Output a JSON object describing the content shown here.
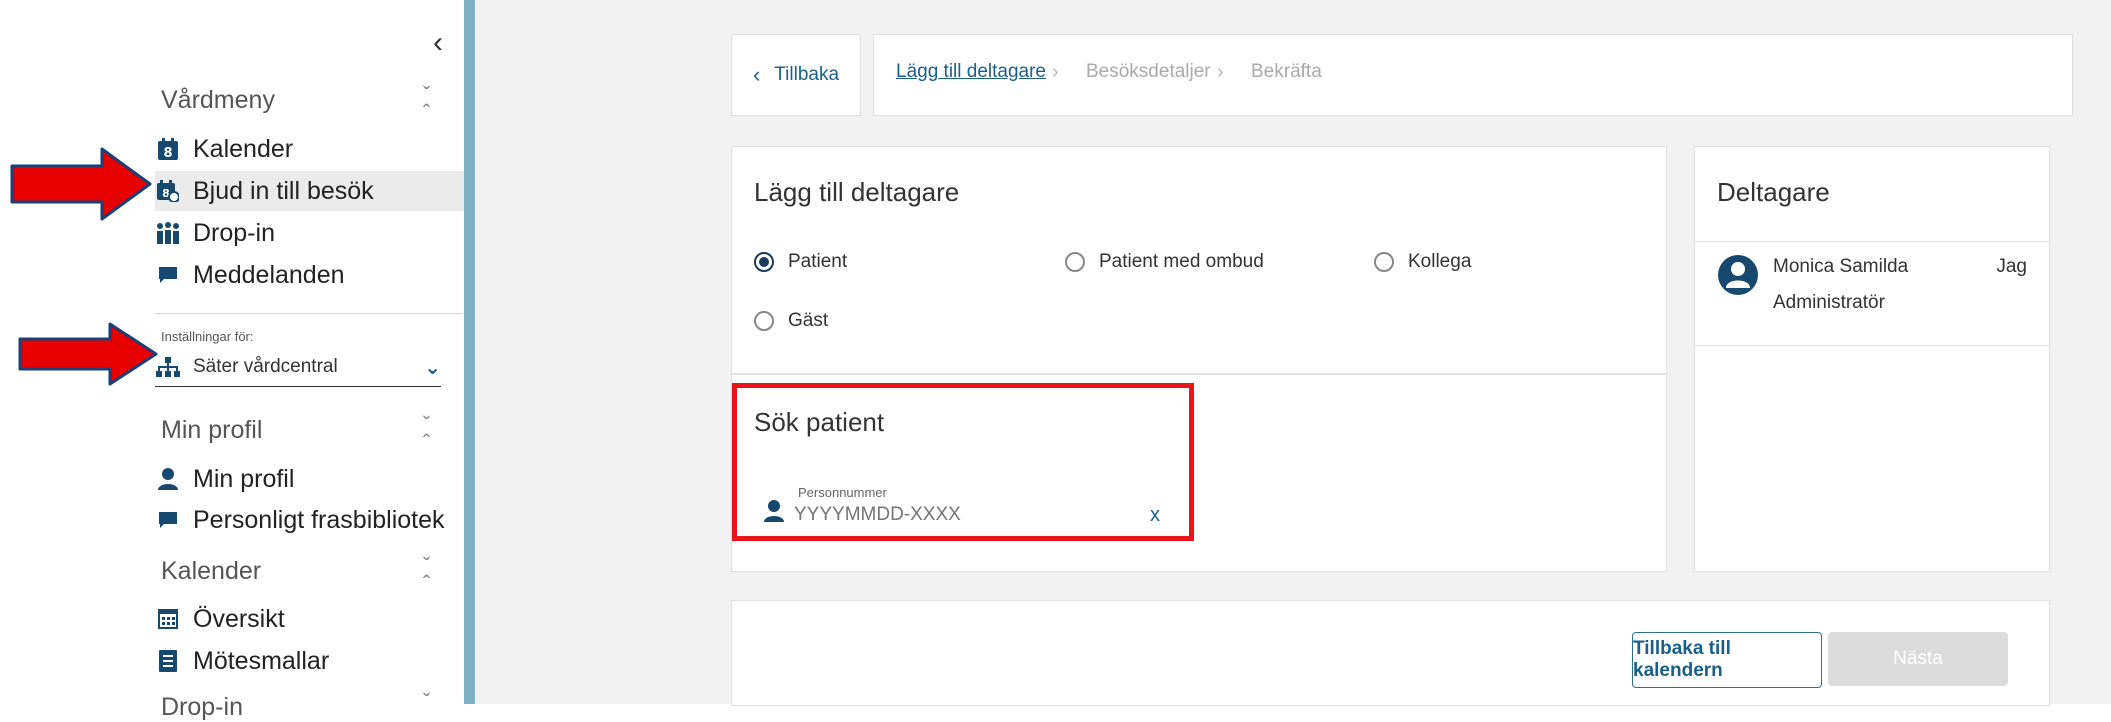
{
  "sidebar": {
    "collapse_icon": "chevron-left-icon",
    "vardmeny": {
      "title": "Vårdmeny",
      "items": [
        {
          "label": "Kalender",
          "icon": "calendar-8-icon"
        },
        {
          "label": "Bjud in till besök",
          "icon": "calendar-invite-icon"
        },
        {
          "label": "Drop-in",
          "icon": "people-icon"
        },
        {
          "label": "Meddelanden",
          "icon": "chat-icon"
        }
      ]
    },
    "settings": {
      "label": "Inställningar för:",
      "value": "Säter vårdcentral",
      "icon": "org-chart-icon"
    },
    "min_profil": {
      "title": "Min profil",
      "items": [
        {
          "label": "Min profil",
          "icon": "user-icon"
        },
        {
          "label": "Personligt frasbibliotek",
          "icon": "chat-icon"
        }
      ]
    },
    "kalender": {
      "title": "Kalender",
      "items": [
        {
          "label": "Översikt",
          "icon": "calendar-grid-icon"
        },
        {
          "label": "Mötesmallar",
          "icon": "document-list-icon"
        }
      ]
    },
    "cut_off": {
      "title": "Drop-in"
    }
  },
  "topbar": {
    "back_label": "Tillbaka",
    "breadcrumbs": [
      "Lägg till deltagare",
      "Besöksdetaljer",
      "Bekräfta"
    ]
  },
  "add_participant": {
    "title": "Lägg till deltagare",
    "options": [
      "Patient",
      "Patient med ombud",
      "Kollega",
      "Gäst"
    ],
    "selected": "Patient"
  },
  "search": {
    "title": "Sök patient",
    "field_label": "Personnummer",
    "placeholder": "YYYYMMDD-XXXX",
    "clear_label": "x"
  },
  "participants": {
    "title": "Deltagare",
    "items": [
      {
        "name": "Monica Samilda",
        "role": "Administratör",
        "tag": "Jag"
      }
    ]
  },
  "footer": {
    "back_to_calendar": "Tillbaka till kalendern",
    "next": "Nästa"
  },
  "colors": {
    "accent": "#1a5f8a",
    "sidebar_border": "#7fb1c6",
    "highlight_red": "#e8161a",
    "arrow_red": "#e60000",
    "icon_navy": "#17496e"
  }
}
